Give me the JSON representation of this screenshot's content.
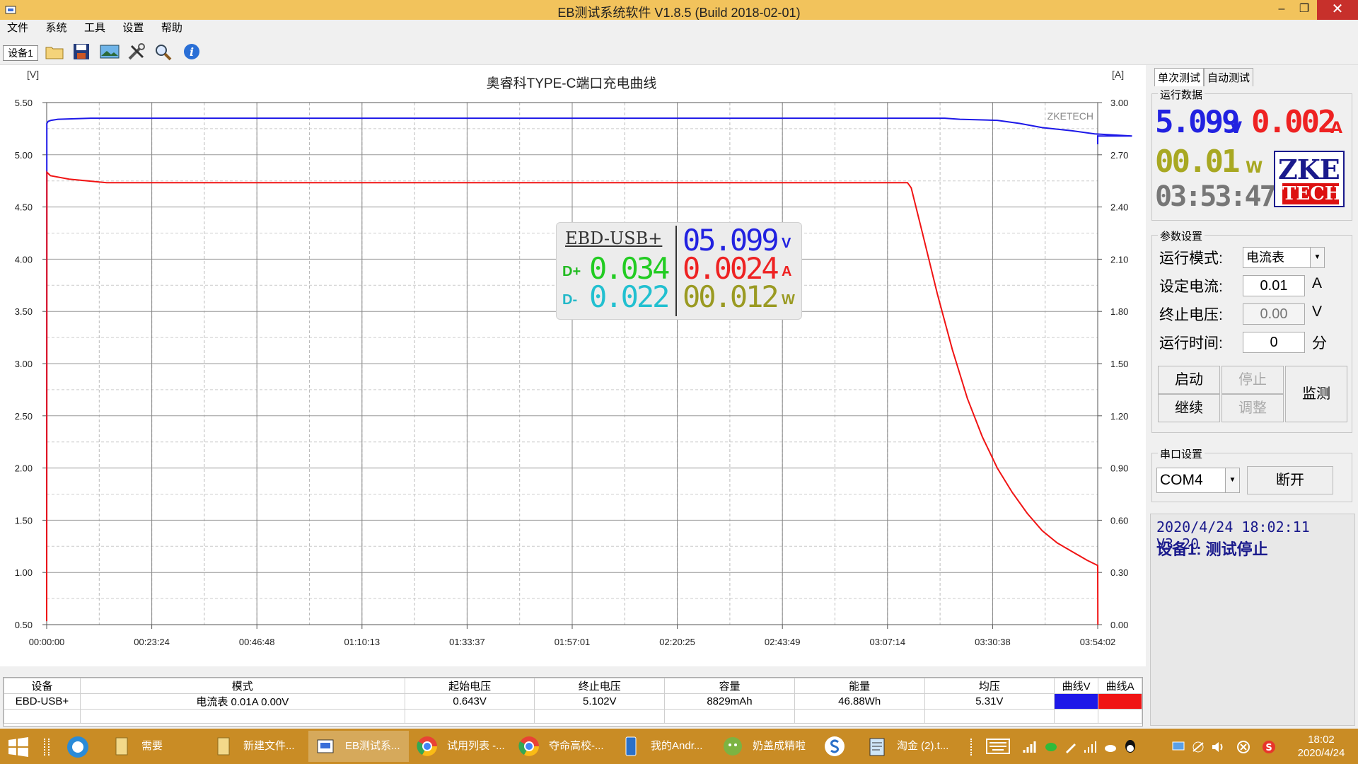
{
  "window": {
    "title": "EB测试系统软件 V1.8.5 (Build 2018-02-01)",
    "controls": {
      "minimize": "–",
      "maximize": "❐",
      "close": "✕"
    }
  },
  "menu": [
    "文件",
    "系统",
    "工具",
    "设置",
    "帮助"
  ],
  "toolbar": {
    "device_label": "设备1",
    "icons": [
      "open-folder-icon",
      "save-icon",
      "image-icon",
      "tools-icon",
      "search-icon",
      "info-icon"
    ]
  },
  "chart_data": {
    "type": "line",
    "title": "奥睿科TYPE-C端口充电曲线",
    "watermark": "ZKETECH",
    "left_axis": {
      "label": "[V]",
      "min": 0.5,
      "max": 5.5,
      "ticks": [
        "5.50",
        "5.00",
        "4.50",
        "4.00",
        "3.50",
        "3.00",
        "2.50",
        "2.00",
        "1.50",
        "1.00",
        "0.50"
      ]
    },
    "right_axis": {
      "label": "[A]",
      "min": 0.0,
      "max": 3.0,
      "ticks": [
        "3.00",
        "2.70",
        "2.40",
        "2.10",
        "1.80",
        "1.50",
        "1.20",
        "0.90",
        "0.60",
        "0.30",
        "0.00"
      ]
    },
    "x_ticks": [
      "00:00:00",
      "00:23:24",
      "00:46:48",
      "01:10:13",
      "01:33:37",
      "01:57:01",
      "02:20:25",
      "02:43:49",
      "03:07:14",
      "03:30:38",
      "03:54:02"
    ],
    "grid": true,
    "series": [
      {
        "axis": "left",
        "color": "#1d18e8",
        "points": [
          [
            0,
            0.55
          ],
          [
            2,
            5.3
          ],
          [
            20,
            5.32
          ],
          [
            60,
            5.33
          ],
          [
            150,
            5.34
          ],
          [
            600,
            5.35
          ],
          [
            9000,
            5.35
          ],
          [
            12000,
            5.35
          ],
          [
            12200,
            5.34
          ],
          [
            12700,
            5.33
          ],
          [
            13000,
            5.3
          ],
          [
            13300,
            5.26
          ],
          [
            13700,
            5.23
          ],
          [
            14000,
            5.2
          ],
          [
            14500,
            5.18
          ],
          [
            14042,
            5.18
          ],
          [
            14042,
            5.1
          ]
        ]
      },
      {
        "axis": "right",
        "color": "#f01414",
        "points": [
          [
            0,
            0.02
          ],
          [
            3,
            2.6
          ],
          [
            50,
            2.58
          ],
          [
            300,
            2.56
          ],
          [
            800,
            2.54
          ],
          [
            11500,
            2.54
          ],
          [
            11550,
            2.51
          ],
          [
            11700,
            2.25
          ],
          [
            11900,
            1.9
          ],
          [
            12100,
            1.58
          ],
          [
            12300,
            1.3
          ],
          [
            12500,
            1.08
          ],
          [
            12700,
            0.9
          ],
          [
            12900,
            0.76
          ],
          [
            13100,
            0.64
          ],
          [
            13300,
            0.54
          ],
          [
            13500,
            0.47
          ],
          [
            13700,
            0.42
          ],
          [
            13900,
            0.37
          ],
          [
            14042,
            0.34
          ],
          [
            14044,
            0.0
          ]
        ]
      }
    ]
  },
  "overlay": {
    "device": "EBD-USB+",
    "voltage": "05.099",
    "voltage_unit": "V",
    "current": "0.0024",
    "current_unit": "A",
    "dplus_label": "D+",
    "dplus": "0.034",
    "dminus_label": "D-",
    "dminus": "0.022",
    "power": "00.012",
    "power_unit": "W"
  },
  "panel": {
    "tabs": [
      "单次测试",
      "自动测试"
    ],
    "run_data_label": "运行数据",
    "voltage": "5.099",
    "voltage_unit": "V",
    "current": "0.002",
    "current_unit": "A",
    "power": "00.01",
    "power_unit": "W",
    "elapsed": "03:53:47",
    "logo_top": "ZKE",
    "logo_bottom": "TECH",
    "params_label": "参数设置",
    "mode_label": "运行模式:",
    "mode_value": "电流表",
    "current_set_label": "设定电流:",
    "current_set_value": "0.01",
    "current_set_unit": "A",
    "cutoff_label": "终止电压:",
    "cutoff_value": "0.00",
    "cutoff_unit": "V",
    "runtime_label": "运行时间:",
    "runtime_value": "0",
    "runtime_unit": "分",
    "btn_start": "启动",
    "btn_stop": "停止",
    "btn_continue": "继续",
    "btn_adjust": "调整",
    "btn_monitor": "监测",
    "serial_label": "串口设置",
    "port_value": "COM4",
    "btn_disconnect": "断开",
    "status_line1": "2020/4/24 18:02:11  V3.20",
    "status_line2": "设备1: 测试停止"
  },
  "results": {
    "headers": [
      "设备",
      "模式",
      "起始电压",
      "终止电压",
      "容量",
      "能量",
      "均压",
      "曲线V",
      "曲线A"
    ],
    "row": [
      "EBD-USB+",
      "电流表  0.01A  0.00V",
      "0.643V",
      "5.102V",
      "8829mAh",
      "46.88Wh",
      "5.31V"
    ],
    "curve_v_color": "#1d18e8",
    "curve_a_color": "#f01414"
  },
  "taskbar": {
    "items": [
      "需要",
      "新建文件...",
      "EB测试系...",
      "试用列表 -...",
      "夺命高校-...",
      "我的Andr...",
      "奶盖成精啦",
      "",
      "淘金 (2).t..."
    ],
    "clock_time": "18:02",
    "clock_date": "2020/4/24"
  }
}
